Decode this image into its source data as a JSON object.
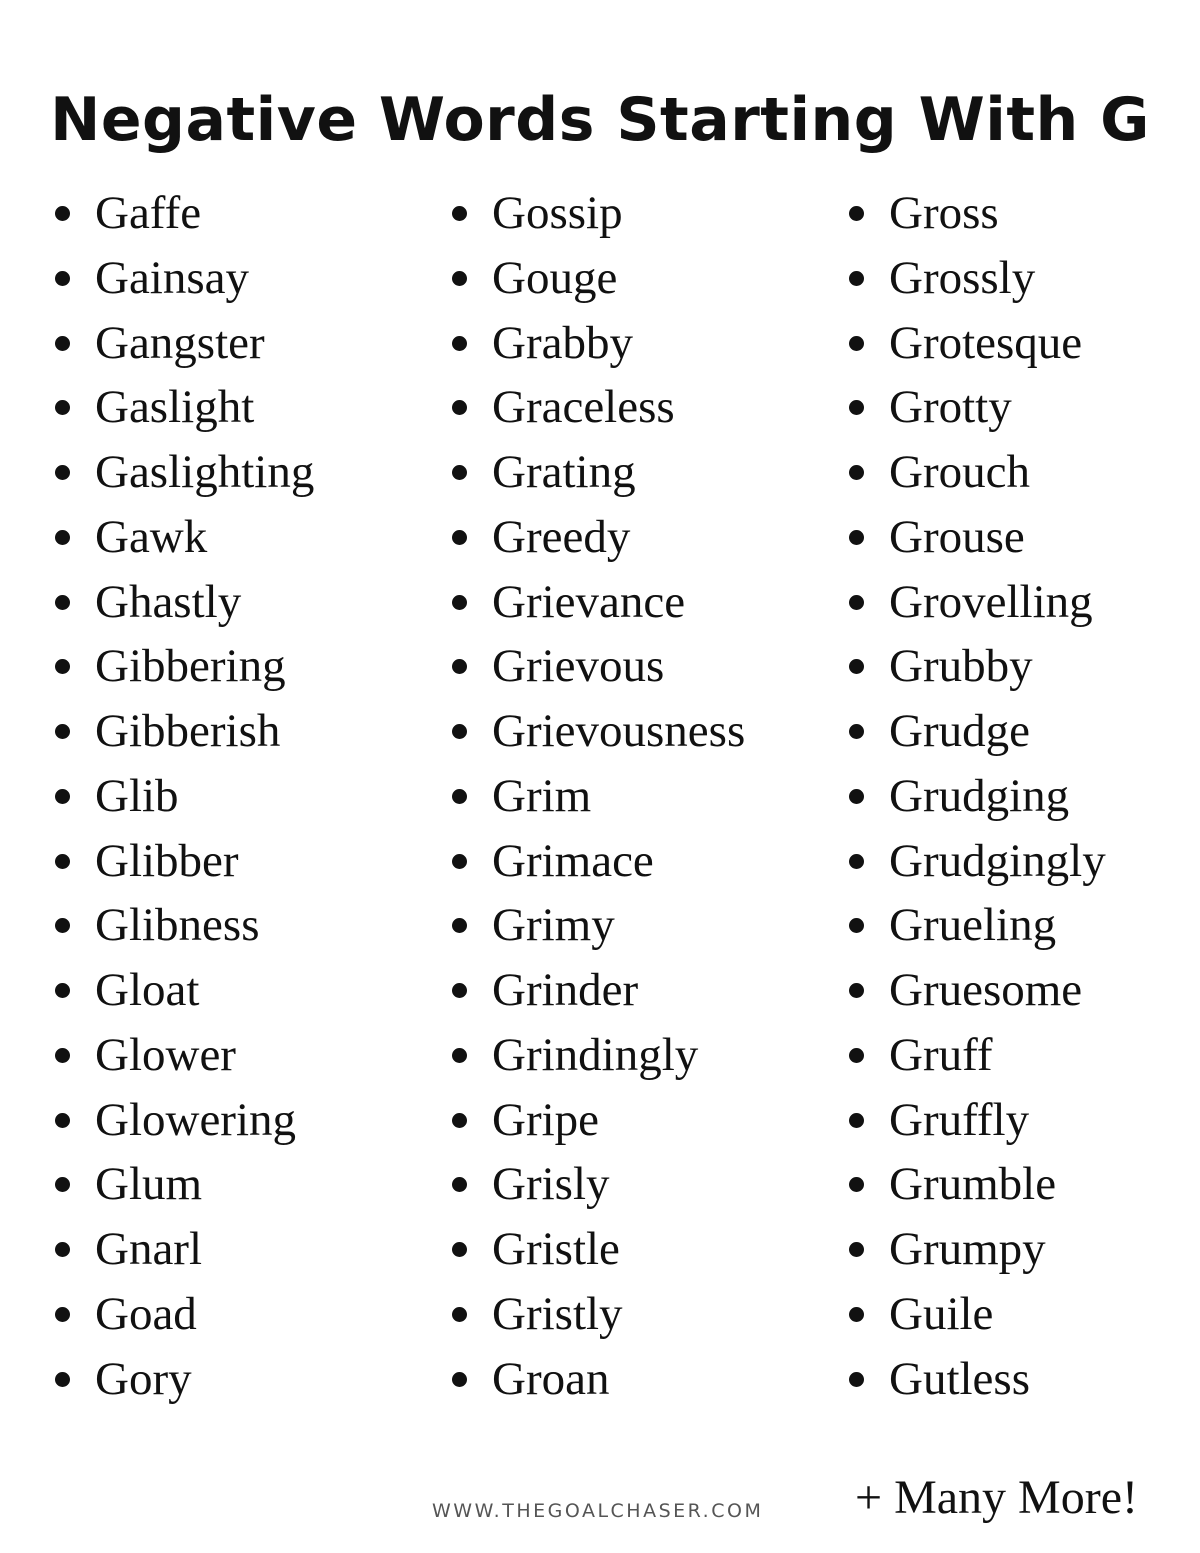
{
  "header": {
    "title": "Negative Words Starting With G"
  },
  "columns": [
    {
      "items": [
        "Gaffe",
        "Gainsay",
        "Gangster",
        "Gaslight",
        "Gaslighting",
        "Gawk",
        "Ghastly",
        "Gibbering",
        "Gibberish",
        "Glib",
        "Glibber",
        "Glibness",
        "Gloat",
        "Glower",
        "Glowering",
        "Glum",
        "Gnarl",
        "Goad",
        "Gory"
      ]
    },
    {
      "items": [
        "Gossip",
        "Gouge",
        "Grabby",
        "Graceless",
        "Grating",
        "Greedy",
        "Grievance",
        "Grievous",
        "Grievousness",
        "Grim",
        "Grimace",
        "Grimy",
        "Grinder",
        "Grindingly",
        "Gripe",
        "Grisly",
        "Gristle",
        "Gristly",
        "Groan"
      ]
    },
    {
      "items": [
        "Gross",
        "Grossly",
        "Grotesque",
        "Grotty",
        "Grouch",
        "Grouse",
        "Grovelling",
        "Grubby",
        "Grudge",
        "Grudging",
        "Grudgingly",
        "Grueling",
        "Gruesome",
        "Gruff",
        "Gruffly",
        "Grumble",
        "Grumpy",
        "Guile",
        "Gutless"
      ]
    }
  ],
  "footer": {
    "website": "WWW.THEGOALCHASER.COM",
    "more_label": "+ Many More!"
  },
  "icons": {
    "list_bullet": "bullet-dot"
  }
}
